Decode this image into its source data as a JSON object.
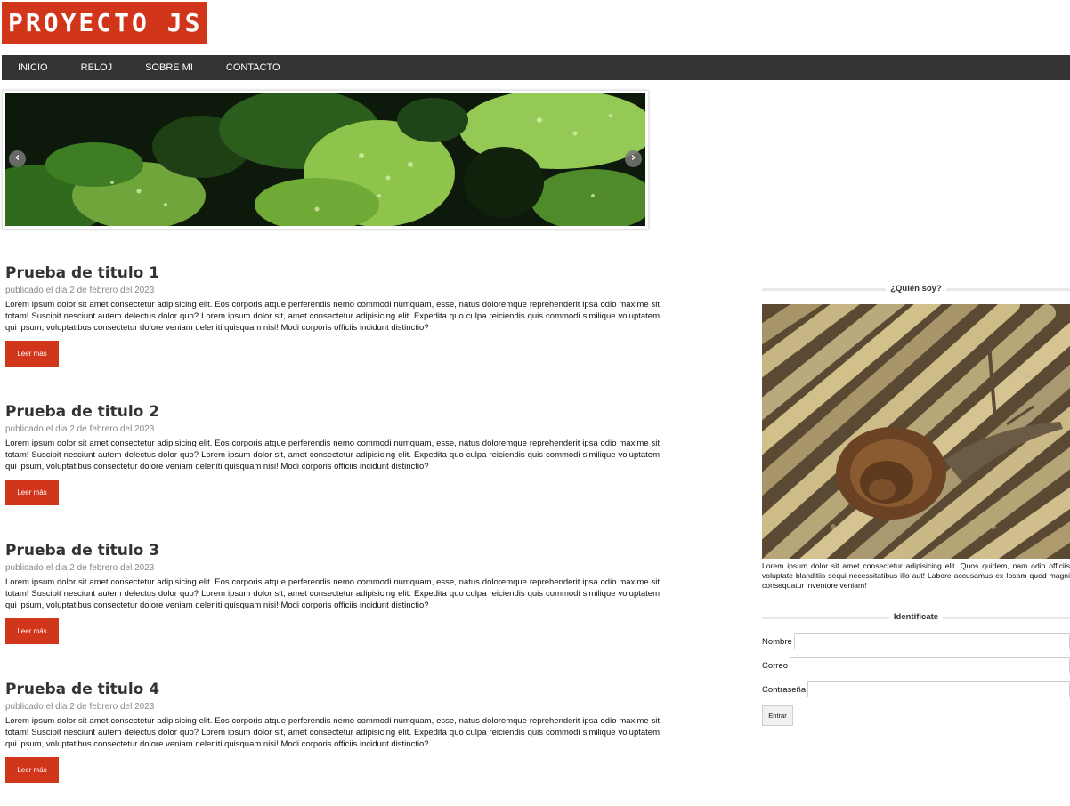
{
  "header": {
    "logo_text": "PROYECTO JS"
  },
  "nav": {
    "items": [
      {
        "label": "INICIO"
      },
      {
        "label": "RELOJ"
      },
      {
        "label": "SOBRE MI"
      },
      {
        "label": "CONTACTO"
      }
    ]
  },
  "slider": {
    "prev_icon": "‹",
    "next_icon": "›",
    "image": "leaves-with-water-drops"
  },
  "articles": [
    {
      "title": "Prueba de titulo 1",
      "date": "publicado el dia 2 de febrero del 2023",
      "body": "Lorem ipsum dolor sit amet consectetur adipisicing elit. Eos corporis atque perferendis nemo commodi numquam, esse, natus doloremque reprehenderit ipsa odio maxime sit totam! Suscipit nesciunt autem delectus dolor quo? Lorem ipsum dolor sit, amet consectetur adipisicing elit. Expedita quo culpa reiciendis quis commodi similique voluptatem qui ipsum, voluptatibus consectetur dolore veniam deleniti quisquam nisi! Modi corporis officiis incidunt distinctio?",
      "button": "Leer más"
    },
    {
      "title": "Prueba de titulo 2",
      "date": "publicado el dia 2 de febrero del 2023",
      "body": "Lorem ipsum dolor sit amet consectetur adipisicing elit. Eos corporis atque perferendis nemo commodi numquam, esse, natus doloremque reprehenderit ipsa odio maxime sit totam! Suscipit nesciunt autem delectus dolor quo? Lorem ipsum dolor sit, amet consectetur adipisicing elit. Expedita quo culpa reiciendis quis commodi similique voluptatem qui ipsum, voluptatibus consectetur dolore veniam deleniti quisquam nisi! Modi corporis officiis incidunt distinctio?",
      "button": "Leer más"
    },
    {
      "title": "Prueba de titulo 3",
      "date": "publicado el dia 2 de febrero del 2023",
      "body": "Lorem ipsum dolor sit amet consectetur adipisicing elit. Eos corporis atque perferendis nemo commodi numquam, esse, natus doloremque reprehenderit ipsa odio maxime sit totam! Suscipit nesciunt autem delectus dolor quo? Lorem ipsum dolor sit, amet consectetur adipisicing elit. Expedita quo culpa reiciendis quis commodi similique voluptatem qui ipsum, voluptatibus consectetur dolore veniam deleniti quisquam nisi! Modi corporis officiis incidunt distinctio?",
      "button": "Leer más"
    },
    {
      "title": "Prueba de titulo 4",
      "date": "publicado el dia 2 de febrero del 2023",
      "body": "Lorem ipsum dolor sit amet consectetur adipisicing elit. Eos corporis atque perferendis nemo commodi numquam, esse, natus doloremque reprehenderit ipsa odio maxime sit totam! Suscipit nesciunt autem delectus dolor quo? Lorem ipsum dolor sit, amet consectetur adipisicing elit. Expedita quo culpa reiciendis quis commodi similique voluptatem qui ipsum, voluptatibus consectetur dolore veniam deleniti quisquam nisi! Modi corporis officiis incidunt distinctio?",
      "button": "Leer más"
    }
  ],
  "sidebar": {
    "about": {
      "title": "¿Quién soy?",
      "image": "snail-on-bamboo",
      "text": "Lorem ipsum dolor sit amet consectetur adipisicing elit. Quos quidem, nam odio officiis voluptate blanditiis sequi necessitatibus illo aut! Labore accusamus ex Ipsam quod magni consequatur inventore veniam!"
    },
    "login": {
      "title": "Identificate",
      "name_label": "Nombre",
      "email_label": "Correo",
      "password_label": "Contraseña",
      "name_value": "",
      "email_value": "",
      "password_value": "",
      "submit_label": "Entrar"
    }
  },
  "colors": {
    "brand": "#d1361b",
    "nav_bg": "#333333",
    "text": "#222222"
  }
}
